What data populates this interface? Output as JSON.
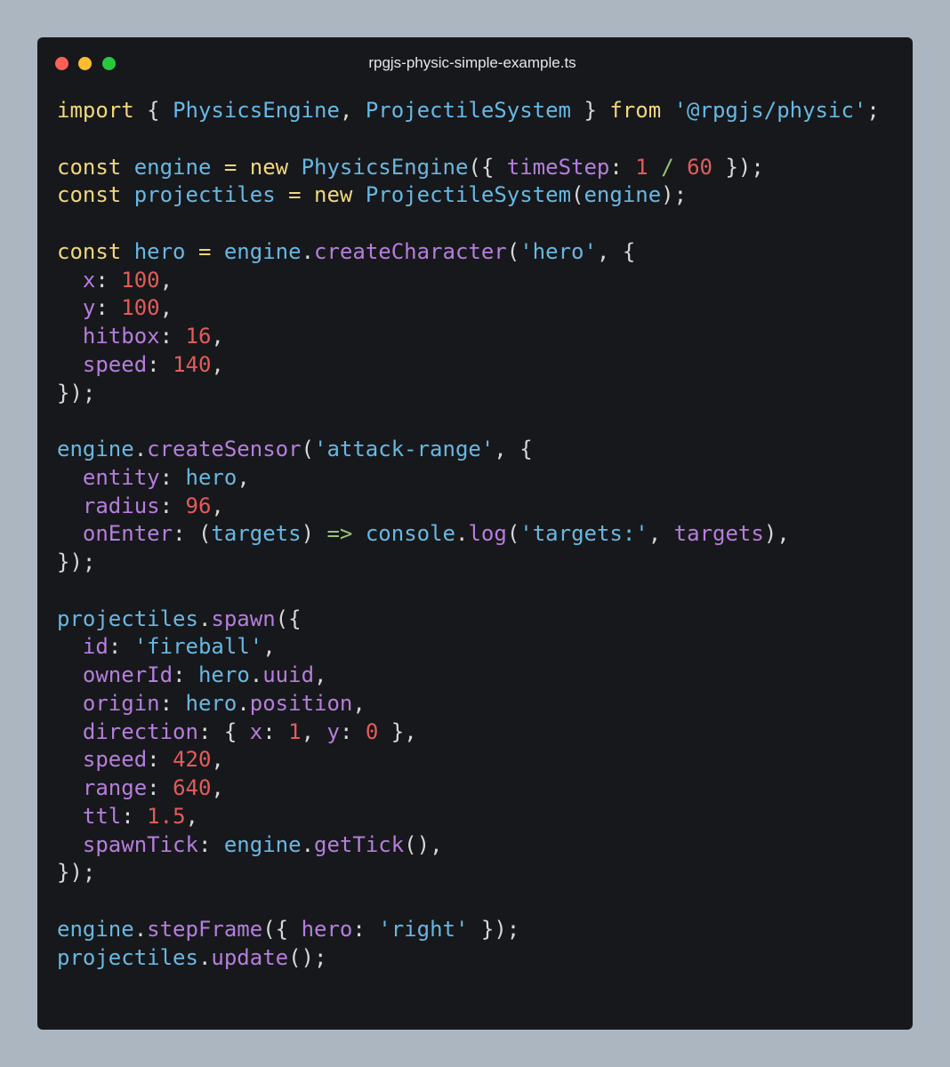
{
  "window": {
    "title": "rpgjs-physic-simple-example.ts",
    "colors": {
      "background": "#abb6c0",
      "editor": "#17181b",
      "close": "#ff5f57",
      "minimize": "#febc2e",
      "maximize": "#28c840"
    }
  },
  "code": {
    "lines": [
      [
        [
          "keyword",
          "import"
        ],
        [
          "plain",
          " "
        ],
        [
          "punct",
          "{"
        ],
        [
          "plain",
          " "
        ],
        [
          "class",
          "PhysicsEngine"
        ],
        [
          "punct",
          ","
        ],
        [
          "plain",
          " "
        ],
        [
          "class",
          "ProjectileSystem"
        ],
        [
          "plain",
          " "
        ],
        [
          "punct",
          "}"
        ],
        [
          "plain",
          " "
        ],
        [
          "keyword",
          "from"
        ],
        [
          "plain",
          " "
        ],
        [
          "string",
          "'@rpgjs/physic'"
        ],
        [
          "punct",
          ";"
        ]
      ],
      [],
      [
        [
          "keyword",
          "const"
        ],
        [
          "plain",
          " "
        ],
        [
          "var",
          "engine"
        ],
        [
          "plain",
          " "
        ],
        [
          "op",
          "="
        ],
        [
          "plain",
          " "
        ],
        [
          "keyword",
          "new"
        ],
        [
          "plain",
          " "
        ],
        [
          "class",
          "PhysicsEngine"
        ],
        [
          "punct",
          "({"
        ],
        [
          "plain",
          " "
        ],
        [
          "prop",
          "timeStep"
        ],
        [
          "punct",
          ":"
        ],
        [
          "plain",
          " "
        ],
        [
          "number",
          "1"
        ],
        [
          "plain",
          " "
        ],
        [
          "slash",
          "/"
        ],
        [
          "plain",
          " "
        ],
        [
          "number",
          "60"
        ],
        [
          "plain",
          " "
        ],
        [
          "punct",
          "});"
        ]
      ],
      [
        [
          "keyword",
          "const"
        ],
        [
          "plain",
          " "
        ],
        [
          "var",
          "projectiles"
        ],
        [
          "plain",
          " "
        ],
        [
          "op",
          "="
        ],
        [
          "plain",
          " "
        ],
        [
          "keyword",
          "new"
        ],
        [
          "plain",
          " "
        ],
        [
          "class",
          "ProjectileSystem"
        ],
        [
          "punct",
          "("
        ],
        [
          "var",
          "engine"
        ],
        [
          "punct",
          ");"
        ]
      ],
      [],
      [
        [
          "keyword",
          "const"
        ],
        [
          "plain",
          " "
        ],
        [
          "var",
          "hero"
        ],
        [
          "plain",
          " "
        ],
        [
          "op",
          "="
        ],
        [
          "plain",
          " "
        ],
        [
          "var",
          "engine"
        ],
        [
          "punct",
          "."
        ],
        [
          "method",
          "createCharacter"
        ],
        [
          "punct",
          "("
        ],
        [
          "string",
          "'hero'"
        ],
        [
          "punct",
          ","
        ],
        [
          "plain",
          " "
        ],
        [
          "punct",
          "{"
        ]
      ],
      [
        [
          "plain",
          "  "
        ],
        [
          "prop",
          "x"
        ],
        [
          "punct",
          ":"
        ],
        [
          "plain",
          " "
        ],
        [
          "number",
          "100"
        ],
        [
          "punct",
          ","
        ]
      ],
      [
        [
          "plain",
          "  "
        ],
        [
          "prop",
          "y"
        ],
        [
          "punct",
          ":"
        ],
        [
          "plain",
          " "
        ],
        [
          "number",
          "100"
        ],
        [
          "punct",
          ","
        ]
      ],
      [
        [
          "plain",
          "  "
        ],
        [
          "prop",
          "hitbox"
        ],
        [
          "punct",
          ":"
        ],
        [
          "plain",
          " "
        ],
        [
          "number",
          "16"
        ],
        [
          "punct",
          ","
        ]
      ],
      [
        [
          "plain",
          "  "
        ],
        [
          "prop",
          "speed"
        ],
        [
          "punct",
          ":"
        ],
        [
          "plain",
          " "
        ],
        [
          "number",
          "140"
        ],
        [
          "punct",
          ","
        ]
      ],
      [
        [
          "punct",
          "});"
        ]
      ],
      [],
      [
        [
          "var",
          "engine"
        ],
        [
          "punct",
          "."
        ],
        [
          "method",
          "createSensor"
        ],
        [
          "punct",
          "("
        ],
        [
          "string",
          "'attack-range'"
        ],
        [
          "punct",
          ","
        ],
        [
          "plain",
          " "
        ],
        [
          "punct",
          "{"
        ]
      ],
      [
        [
          "plain",
          "  "
        ],
        [
          "prop",
          "entity"
        ],
        [
          "punct",
          ":"
        ],
        [
          "plain",
          " "
        ],
        [
          "var",
          "hero"
        ],
        [
          "punct",
          ","
        ]
      ],
      [
        [
          "plain",
          "  "
        ],
        [
          "prop",
          "radius"
        ],
        [
          "punct",
          ":"
        ],
        [
          "plain",
          " "
        ],
        [
          "number",
          "96"
        ],
        [
          "punct",
          ","
        ]
      ],
      [
        [
          "plain",
          "  "
        ],
        [
          "prop",
          "onEnter"
        ],
        [
          "punct",
          ":"
        ],
        [
          "plain",
          " "
        ],
        [
          "punct",
          "("
        ],
        [
          "var",
          "targets"
        ],
        [
          "punct",
          ")"
        ],
        [
          "plain",
          " "
        ],
        [
          "arrow",
          "=>"
        ],
        [
          "plain",
          " "
        ],
        [
          "var",
          "console"
        ],
        [
          "punct",
          "."
        ],
        [
          "method",
          "log"
        ],
        [
          "punct",
          "("
        ],
        [
          "string",
          "'targets:'"
        ],
        [
          "punct",
          ","
        ],
        [
          "plain",
          " "
        ],
        [
          "prop",
          "targets"
        ],
        [
          "punct",
          "),"
        ]
      ],
      [
        [
          "punct",
          "});"
        ]
      ],
      [],
      [
        [
          "var",
          "projectiles"
        ],
        [
          "punct",
          "."
        ],
        [
          "method",
          "spawn"
        ],
        [
          "punct",
          "({"
        ]
      ],
      [
        [
          "plain",
          "  "
        ],
        [
          "prop",
          "id"
        ],
        [
          "punct",
          ":"
        ],
        [
          "plain",
          " "
        ],
        [
          "string",
          "'fireball'"
        ],
        [
          "punct",
          ","
        ]
      ],
      [
        [
          "plain",
          "  "
        ],
        [
          "prop",
          "ownerId"
        ],
        [
          "punct",
          ":"
        ],
        [
          "plain",
          " "
        ],
        [
          "var",
          "hero"
        ],
        [
          "punct",
          "."
        ],
        [
          "prop",
          "uuid"
        ],
        [
          "punct",
          ","
        ]
      ],
      [
        [
          "plain",
          "  "
        ],
        [
          "prop",
          "origin"
        ],
        [
          "punct",
          ":"
        ],
        [
          "plain",
          " "
        ],
        [
          "var",
          "hero"
        ],
        [
          "punct",
          "."
        ],
        [
          "prop",
          "position"
        ],
        [
          "punct",
          ","
        ]
      ],
      [
        [
          "plain",
          "  "
        ],
        [
          "prop",
          "direction"
        ],
        [
          "punct",
          ":"
        ],
        [
          "plain",
          " "
        ],
        [
          "punct",
          "{"
        ],
        [
          "plain",
          " "
        ],
        [
          "prop",
          "x"
        ],
        [
          "punct",
          ":"
        ],
        [
          "plain",
          " "
        ],
        [
          "number",
          "1"
        ],
        [
          "punct",
          ","
        ],
        [
          "plain",
          " "
        ],
        [
          "prop",
          "y"
        ],
        [
          "punct",
          ":"
        ],
        [
          "plain",
          " "
        ],
        [
          "number",
          "0"
        ],
        [
          "plain",
          " "
        ],
        [
          "punct",
          "},"
        ]
      ],
      [
        [
          "plain",
          "  "
        ],
        [
          "prop",
          "speed"
        ],
        [
          "punct",
          ":"
        ],
        [
          "plain",
          " "
        ],
        [
          "number",
          "420"
        ],
        [
          "punct",
          ","
        ]
      ],
      [
        [
          "plain",
          "  "
        ],
        [
          "prop",
          "range"
        ],
        [
          "punct",
          ":"
        ],
        [
          "plain",
          " "
        ],
        [
          "number",
          "640"
        ],
        [
          "punct",
          ","
        ]
      ],
      [
        [
          "plain",
          "  "
        ],
        [
          "prop",
          "ttl"
        ],
        [
          "punct",
          ":"
        ],
        [
          "plain",
          " "
        ],
        [
          "number",
          "1.5"
        ],
        [
          "punct",
          ","
        ]
      ],
      [
        [
          "plain",
          "  "
        ],
        [
          "prop",
          "spawnTick"
        ],
        [
          "punct",
          ":"
        ],
        [
          "plain",
          " "
        ],
        [
          "var",
          "engine"
        ],
        [
          "punct",
          "."
        ],
        [
          "method",
          "getTick"
        ],
        [
          "punct",
          "(),"
        ]
      ],
      [
        [
          "punct",
          "});"
        ]
      ],
      [],
      [
        [
          "var",
          "engine"
        ],
        [
          "punct",
          "."
        ],
        [
          "method",
          "stepFrame"
        ],
        [
          "punct",
          "({"
        ],
        [
          "plain",
          " "
        ],
        [
          "prop",
          "hero"
        ],
        [
          "punct",
          ":"
        ],
        [
          "plain",
          " "
        ],
        [
          "string",
          "'right'"
        ],
        [
          "plain",
          " "
        ],
        [
          "punct",
          "});"
        ]
      ],
      [
        [
          "var",
          "projectiles"
        ],
        [
          "punct",
          "."
        ],
        [
          "method",
          "update"
        ],
        [
          "punct",
          "();"
        ]
      ]
    ]
  }
}
